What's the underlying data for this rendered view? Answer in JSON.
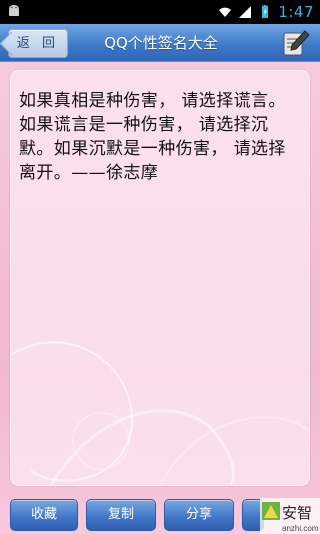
{
  "status_bar": {
    "time": "1:47",
    "icons": [
      "android-icon",
      "wifi-icon",
      "signal-icon",
      "battery-icon"
    ]
  },
  "header": {
    "back_label": "返 回",
    "title": "QQ个性签名大全",
    "pen_icon": "pen-icon"
  },
  "content": {
    "quote": "如果真相是种伤害， 请选择谎言。 如果谎言是一种伤害， 请选择沉默。如果沉默是一种伤害， 请选择离开。——徐志摩"
  },
  "footer": {
    "buttons": [
      {
        "label": "收藏"
      },
      {
        "label": "复制"
      },
      {
        "label": "分享"
      },
      {
        "label": ""
      }
    ]
  },
  "watermark": {
    "brand": "安智",
    "site": "anzhi.com"
  },
  "colors": {
    "accent_blue": "#3f7ac8",
    "time_blue": "#33b5e5",
    "pink_bg": "#f4bfd6"
  }
}
